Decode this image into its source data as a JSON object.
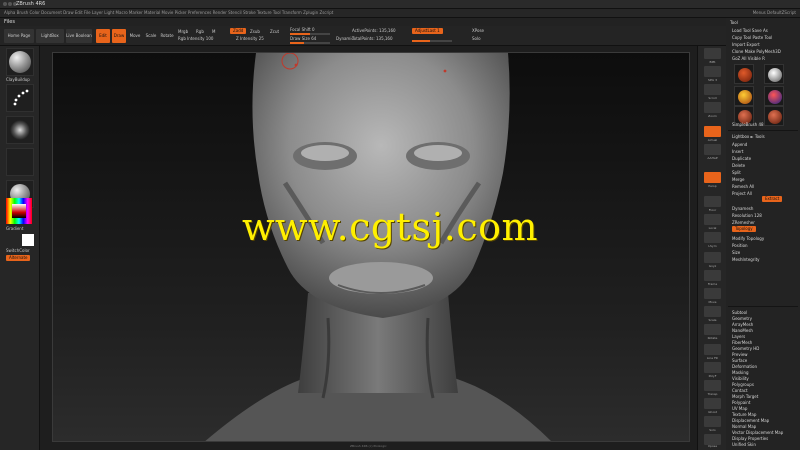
{
  "app": {
    "title": "ZBrush 4R6"
  },
  "menu_bar": {
    "items": "Alpha  Brush  Color  Document  Draw  Edit  File  Layer  Light  Macro  Marker  Material  Movie  Picker  Preferences  Render  Stencil  Stroke  Texture  Tool  Transform  Zplugin  Zscript",
    "right": "Menus  DefaultZScript"
  },
  "file_bar": {
    "label": "Files"
  },
  "top_shelf": {
    "home_page": "Home Page",
    "lightbox": "LightBox",
    "live_boolean": "Live Boolean",
    "edit_label": "Edit",
    "draw_label": "Draw",
    "move_label": "Move",
    "scale_label": "Scale",
    "rotate_label": "Rotate",
    "mrgb": "Mrgb",
    "rgb": "Rgb",
    "m": "M",
    "zadd": "Zadd",
    "zsub": "Zsub",
    "zcut": "Zcut",
    "focal_shift": "Focal Shift 0",
    "draw_size": "Draw Size 64",
    "z_intensity": "Z Intensity 25",
    "rgb_intensity": "Rgb Intensity 100",
    "dynamic": "Dynamic",
    "active_points": "ActivePoints: 135,160",
    "total_points": "TotalPoints: 135,160",
    "adjust_last": "AdjustLast 1",
    "xpose": "XPose",
    "solo": "Solo"
  },
  "left_shelf": {
    "brush_label": "ClayBuildup",
    "stroke_label": "DragRect",
    "alpha_label": "Alpha Off",
    "texture_label": "Texture Off",
    "material_label": "MatCap Gray",
    "gradient": "Gradient",
    "switch_color": "SwitchColor",
    "alternate": "Alternate"
  },
  "viewport": {
    "watermark": "www.cgtsj.com",
    "bottom_label": "ZBrush 4R6 (c) Pixologic"
  },
  "right_shelf": {
    "buttons": [
      "BPR",
      "SPix 3",
      "Scroll",
      "Zoom",
      "Actual",
      "AAHalf",
      "Persp",
      "Floor",
      "Local",
      "LSym",
      "Gxyz",
      "Frame",
      "Move",
      "Scale",
      "Rotate",
      "Line Fill",
      "PolyF",
      "Transp",
      "Ghost",
      "Solo",
      "Xpose"
    ]
  },
  "right_tray": {
    "header": "Tool",
    "sub_header": "Load Tool   Save As",
    "copy_tool": "Copy Tool   Paste Tool",
    "import": "Import   Export",
    "clone": "Clone   Make PolyMesh3D",
    "goz": "GoZ   All   Visible   R",
    "lightbox_tools": "Lightbox ► Tools",
    "current_tool": "SimpleBrush 48",
    "items": [
      "Subtool",
      "Geometry",
      "ArrayMesh",
      "NanoMesh",
      "Layers",
      "FiberMesh",
      "Geometry HD",
      "Preview",
      "Surface",
      "Deformation",
      "Masking",
      "Visibility",
      "Polygroups",
      "Contact",
      "Morph Target",
      "Polypaint",
      "UV Map",
      "Texture Map",
      "Displacement Map",
      "Normal Map",
      "Vector Displacement Map",
      "Display Properties",
      "Unified Skin"
    ],
    "upper_items": [
      "Append",
      "Insert",
      "Duplicate",
      "Delete",
      "Split",
      "Merge",
      "Remesh All",
      "Project All",
      "Extract",
      "Dynamesh",
      "Resolution 128",
      "ZRemesher",
      "Topology",
      "Modify Topology",
      "Position",
      "Size",
      "MeshIntegrity"
    ]
  },
  "colors": {
    "accent": "#e8641b",
    "watermark": "#fff000",
    "panel": "#262626"
  }
}
